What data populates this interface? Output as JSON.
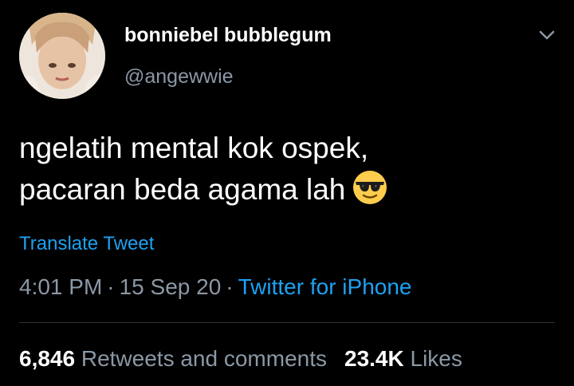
{
  "user": {
    "display_name": "bonniebel bubblegum",
    "handle": "@angewwie"
  },
  "tweet": {
    "line1": "ngelatih mental kok ospek,",
    "line2": "pacaran beda agama lah",
    "emoji": "smiling-face-with-sunglasses"
  },
  "translate_label": "Translate Tweet",
  "meta": {
    "time": "4:01 PM",
    "separator": "·",
    "date": "15 Sep 20",
    "source": "Twitter for iPhone"
  },
  "stats": {
    "retweets_count": "6,846",
    "retweets_label": "Retweets and comments",
    "likes_count": "23.4K",
    "likes_label": "Likes"
  },
  "colors": {
    "background": "#000000",
    "link": "#1da1f2",
    "secondary_text": "#8b98a5",
    "divider": "#2f3336"
  }
}
